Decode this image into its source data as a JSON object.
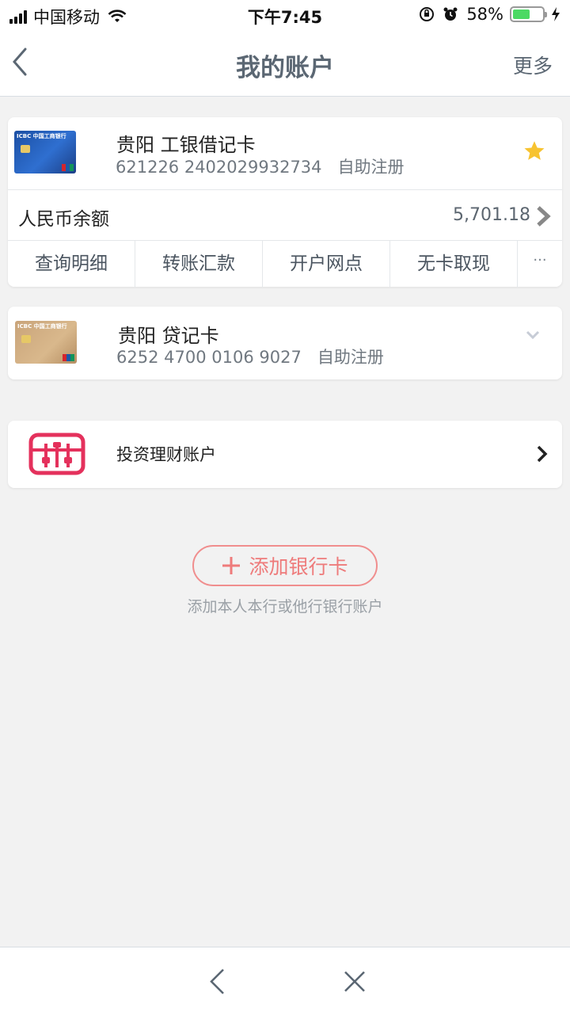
{
  "status_bar": {
    "carrier": "中国移动",
    "time": "下午7:45",
    "battery_percent": "58%",
    "battery_level": 0.58,
    "icons": [
      "signal-icon",
      "wifi-icon",
      "orientation-lock-icon",
      "alarm-icon",
      "battery-icon",
      "charging-icon"
    ]
  },
  "nav": {
    "title": "我的账户",
    "more_label": "更多",
    "back_icon": "chevron-left-icon"
  },
  "accounts": [
    {
      "name": "贵阳 工银借记卡",
      "number": "621226 2402029932734",
      "registration": "自助注册",
      "favorite": true,
      "thumb_logo": "ICBC 中国工商银行",
      "balance": {
        "label": "人民币余额",
        "value": "5,701.18"
      },
      "actions": [
        "查询明细",
        "转账汇款",
        "开户网点",
        "无卡取现"
      ],
      "more_actions": "···"
    },
    {
      "name": "贵阳 贷记卡",
      "number": "6252 4700 0106 9027",
      "registration": "自助注册",
      "thumb_logo": "ICBC 中国工商银行",
      "expanded": false
    }
  ],
  "investment": {
    "label": "投资理财账户",
    "icon": "abacus-icon"
  },
  "add_card": {
    "label": "添加银行卡",
    "hint": "添加本人本行或他行银行账户"
  },
  "bottom_bar": {
    "icons": [
      "back-icon",
      "close-icon"
    ]
  },
  "colors": {
    "accent_red": "#ee7b7b",
    "star": "#f7c331",
    "nav_text": "#5b6773",
    "background": "#f2f2f2"
  }
}
